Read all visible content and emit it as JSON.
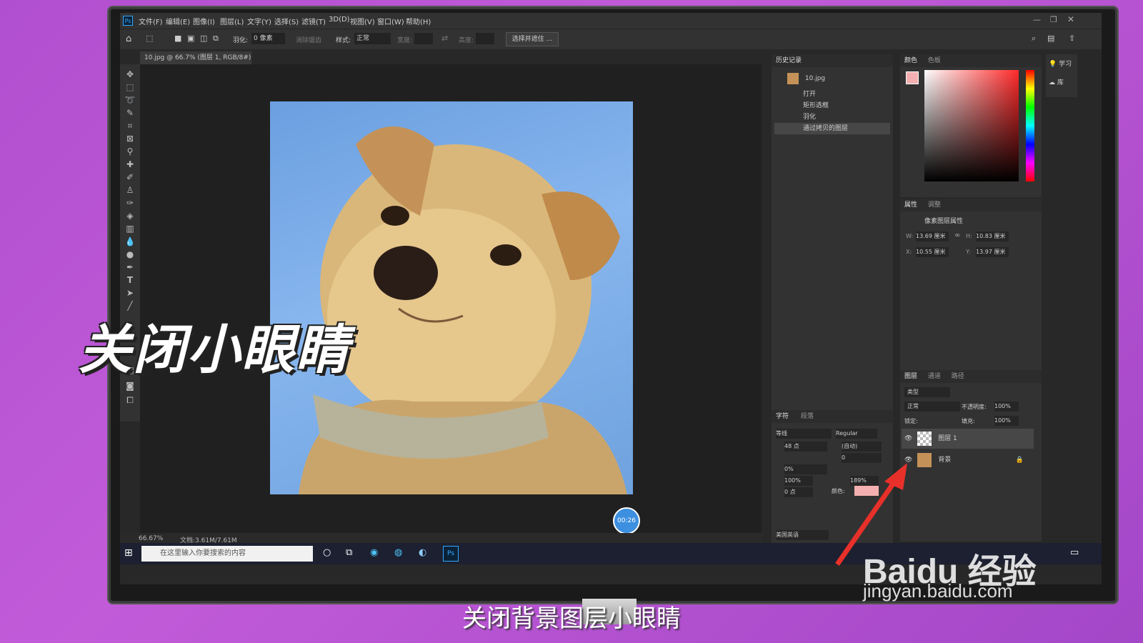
{
  "app": {
    "menu": [
      "文件(F)",
      "编辑(E)",
      "图像(I)",
      "图层(L)",
      "文字(Y)",
      "选择(S)",
      "滤镜(T)",
      "3D(D)",
      "视图(V)",
      "窗口(W)",
      "帮助(H)"
    ],
    "logo": "Ps"
  },
  "options": {
    "feather_label": "羽化:",
    "feather_value": "0 像素",
    "antialias": "消除锯齿",
    "style_label": "样式:",
    "style_value": "正常",
    "width_label": "宽度:",
    "height_label": "高度:",
    "select_mask_button": "选择并遮住 ..."
  },
  "document": {
    "tab_title": "10.jpg @ 66.7% (图层 1, RGB/8#) *",
    "zoom": "66.67%",
    "doc_size": "文档:3.61M/7.61M"
  },
  "timer": "00:26",
  "history": {
    "title": "历史记录",
    "snapshot": "10.jpg",
    "items": [
      "打开",
      "矩形选框",
      "羽化",
      "通过拷贝的图层"
    ]
  },
  "color_panel": {
    "tabs": [
      "颜色",
      "色板"
    ]
  },
  "properties": {
    "tabs": [
      "属性",
      "调整"
    ],
    "subtitle": "像素图层属性",
    "w": "13.69 厘米",
    "h": "10.83 厘米",
    "x": "10.55 厘米",
    "y": "13.97 厘米",
    "w_label": "W:",
    "h_label": "H:",
    "x_label": "X:",
    "y_label": "Y:"
  },
  "character": {
    "tabs": [
      "字符",
      "段落"
    ],
    "font": "等线",
    "style": "Regular",
    "size": "48 点",
    "leading": "(自动)",
    "tracking": "0",
    "scale_percent": "0%",
    "vscale": "100%",
    "hscale": "189%",
    "baseline": "0 点",
    "color_label": "颜色:",
    "language": "美国英语"
  },
  "learn": {
    "learn": "学习",
    "library": "库"
  },
  "layers": {
    "tabs": [
      "图层",
      "通道",
      "路径"
    ],
    "filter": "类型",
    "blend": "正常",
    "opacity_label": "不透明度:",
    "opacity": "100%",
    "lock_label": "锁定:",
    "fill_label": "填充:",
    "fill": "100%",
    "items": [
      {
        "name": "图层 1"
      },
      {
        "name": "背景"
      }
    ]
  },
  "taskbar": {
    "search_placeholder": "在这里输入你要搜索的内容"
  },
  "overlay": {
    "title": "关闭小眼睛",
    "subtitle": "关闭背景图层小眼睛",
    "watermark": "Baidu 经验",
    "watermark_url": "jingyan.baidu.com"
  },
  "colors": {
    "accent": "#31a8ff",
    "background": "#b04fd0",
    "arrow": "#e8302a"
  }
}
